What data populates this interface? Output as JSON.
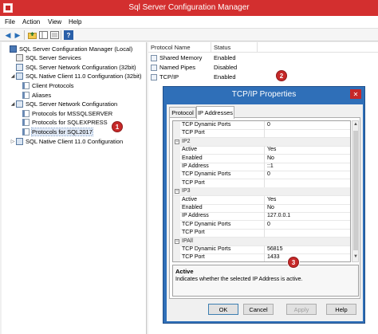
{
  "window": {
    "title": "Sql Server Configuration Manager"
  },
  "menu": [
    "File",
    "Action",
    "View",
    "Help"
  ],
  "toolbar_icons": [
    "back-arrow-icon",
    "forward-arrow-icon",
    "up-folder-icon",
    "show-hide-tree-icon",
    "export-list-icon",
    "help-icon"
  ],
  "tree": [
    {
      "label": "SQL Server Configuration Manager (Local)",
      "level": 0,
      "expander": "",
      "icon": "root"
    },
    {
      "label": "SQL Server Services",
      "level": 1,
      "expander": "",
      "icon": "svc"
    },
    {
      "label": "SQL Server Network Configuration (32bit)",
      "level": 1,
      "expander": "",
      "icon": "net"
    },
    {
      "label": "SQL Native Client 11.0 Configuration (32bit)",
      "level": 1,
      "expander": "◢",
      "icon": "client"
    },
    {
      "label": "Client Protocols",
      "level": 2,
      "expander": "",
      "icon": "prot"
    },
    {
      "label": "Aliases",
      "level": 2,
      "expander": "",
      "icon": "prot"
    },
    {
      "label": "SQL Server Network Configuration",
      "level": 1,
      "expander": "◢",
      "icon": "net"
    },
    {
      "label": "Protocols for MSSQLSERVER",
      "level": 2,
      "expander": "",
      "icon": "prot"
    },
    {
      "label": "Protocols for SQLEXPRESS",
      "level": 2,
      "expander": "",
      "icon": "prot"
    },
    {
      "label": "Protocols for SQL2017",
      "level": 2,
      "expander": "",
      "icon": "prot",
      "selected": true
    },
    {
      "label": "SQL Native Client 11.0 Configuration",
      "level": 1,
      "expander": "▷",
      "icon": "client"
    }
  ],
  "list": {
    "headers": {
      "name": "Protocol Name",
      "status": "Status"
    },
    "rows": [
      {
        "name": "Shared Memory",
        "status": "Enabled"
      },
      {
        "name": "Named Pipes",
        "status": "Disabled"
      },
      {
        "name": "TCP/IP",
        "status": "Enabled"
      }
    ]
  },
  "badges": [
    "1",
    "2",
    "3"
  ],
  "dialog": {
    "title": "TCP/IP Properties",
    "close": "✕",
    "tabs": [
      "Protocol",
      "IP Addresses"
    ],
    "rows": [
      {
        "k": "TCP Dynamic Ports",
        "v": "0"
      },
      {
        "k": "TCP Port",
        "v": ""
      },
      {
        "k": "IP2",
        "v": "",
        "section": true
      },
      {
        "k": "Active",
        "v": "Yes"
      },
      {
        "k": "Enabled",
        "v": "No"
      },
      {
        "k": "IP Address",
        "v": "::1"
      },
      {
        "k": "TCP Dynamic Ports",
        "v": "0"
      },
      {
        "k": "TCP Port",
        "v": ""
      },
      {
        "k": "IP3",
        "v": "",
        "section": true
      },
      {
        "k": "Active",
        "v": "Yes"
      },
      {
        "k": "Enabled",
        "v": "No"
      },
      {
        "k": "IP Address",
        "v": "127.0.0.1"
      },
      {
        "k": "TCP Dynamic Ports",
        "v": "0"
      },
      {
        "k": "TCP Port",
        "v": ""
      },
      {
        "k": "IPAll",
        "v": "",
        "section": true
      },
      {
        "k": "TCP Dynamic Ports",
        "v": "56815"
      },
      {
        "k": "TCP Port",
        "v": "1433"
      }
    ],
    "description": {
      "title": "Active",
      "text": "Indicates whether the selected IP Address is active."
    },
    "buttons": {
      "ok": "OK",
      "cancel": "Cancel",
      "apply": "Apply",
      "help": "Help"
    }
  },
  "colors": {
    "titlebar": "#d32f2f",
    "dialog_frame": "#2f6fb8",
    "badge": "#c62828"
  }
}
